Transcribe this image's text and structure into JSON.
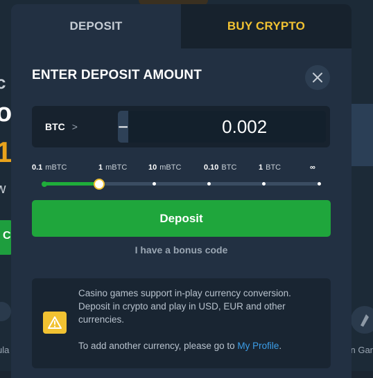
{
  "tabs": {
    "deposit": "DEPOSIT",
    "buy_crypto": "BUY CRYPTO"
  },
  "header": {
    "title": "ENTER DEPOSIT AMOUNT"
  },
  "amount": {
    "currency": "BTC",
    "currency_chevron": ">",
    "value": "0.002",
    "minus": "−",
    "plus": "+"
  },
  "slider": {
    "stops": [
      {
        "value": "0.1",
        "unit": "mBTC"
      },
      {
        "value": "1",
        "unit": "mBTC"
      },
      {
        "value": "10",
        "unit": "mBTC"
      },
      {
        "value": "0.10",
        "unit": "BTC"
      },
      {
        "value": "1",
        "unit": "BTC"
      },
      {
        "value": "∞",
        "unit": ""
      }
    ],
    "selected_index": 1
  },
  "deposit_button": "Deposit",
  "bonus_link": "I have a bonus code",
  "info": {
    "line1": "Casino games support in-play currency conversion. Deposit in crypto and play in USD, EUR and other currencies.",
    "line2_prefix": "To add another currency, please go to ",
    "line2_link": "My Profile",
    "line2_suffix": "."
  },
  "background": {
    "left_text_1": "c",
    "left_text_2": "o",
    "left_text_3": "1",
    "left_text_4": "w",
    "left_label": "ula",
    "right_label": "n Gar",
    "left_button": "C"
  },
  "colors": {
    "accent_green": "#1fa63c",
    "accent_yellow": "#f1c232",
    "link_blue": "#3c9ee8",
    "modal_bg": "#223042"
  }
}
